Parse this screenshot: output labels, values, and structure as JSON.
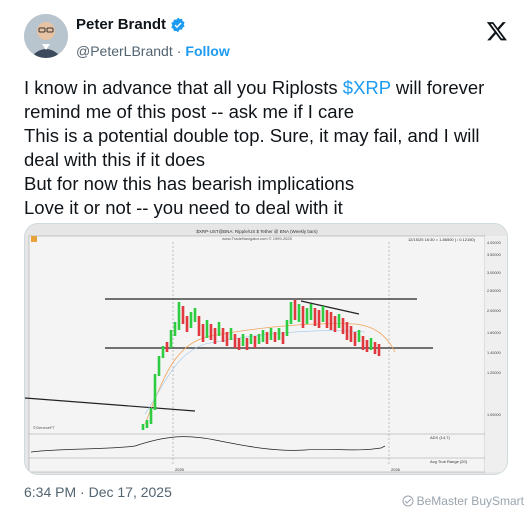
{
  "author": {
    "name": "Peter Brandt",
    "handle": "@PeterLBrandt",
    "separator": "·",
    "follow_label": "Follow"
  },
  "tweet": {
    "line1_before": "I know in advance that all you Riplosts ",
    "line1_cashtag": "$XRP",
    "line1_after": " will forever",
    "line2": "remind me of this post -- ask me if I care",
    "line3": "This is a potential double top. Sure, it may fail, and I will",
    "line4": "deal with this if it does",
    "line5": "But for now this has bearish implications",
    "line6": "Love it or not -- you need to deal with it"
  },
  "chart": {
    "title": "$XRP-UST@BNA: Ripple/US $ Tether @ BNA (Weekly bars)",
    "subtitle": "www.TradeNavigator.com © 1999-2025",
    "date_readout": "12/15/25 16:30 = 1.86500 (↓ 0.12150)",
    "y_ticks": [
      "4.00000",
      "3.50000",
      "3.00000",
      "2.50000",
      "2.00000",
      "1.60000",
      "1.40000",
      "1.20000",
      "1.00000"
    ],
    "x_ticks": [
      "2025",
      "2026"
    ],
    "watermark_label": "©GeneseFT",
    "adx_label": "ADX (14,7)",
    "atr_label": "Avg True Range (20)",
    "chart_data": {
      "type": "candlestick",
      "title": "$XRP-UST@BNA: Ripple/US $ Tether @ BNA (Weekly bars)",
      "x_ticks": [
        "2025",
        "2026"
      ],
      "y_ticks": [
        1.0,
        1.2,
        1.4,
        1.6,
        2.0,
        2.5,
        3.0,
        3.5,
        4.0
      ],
      "last_value": 1.865,
      "last_change": -0.1215
    }
  },
  "timestamp": "6:34 PM · Dec 17, 2025",
  "watermark": "BeMaster BuySmart",
  "colors": {
    "accent": "#1d9bf0",
    "candle_up": "#2ecc40",
    "candle_down": "#e0383e",
    "muted": "#536471"
  }
}
